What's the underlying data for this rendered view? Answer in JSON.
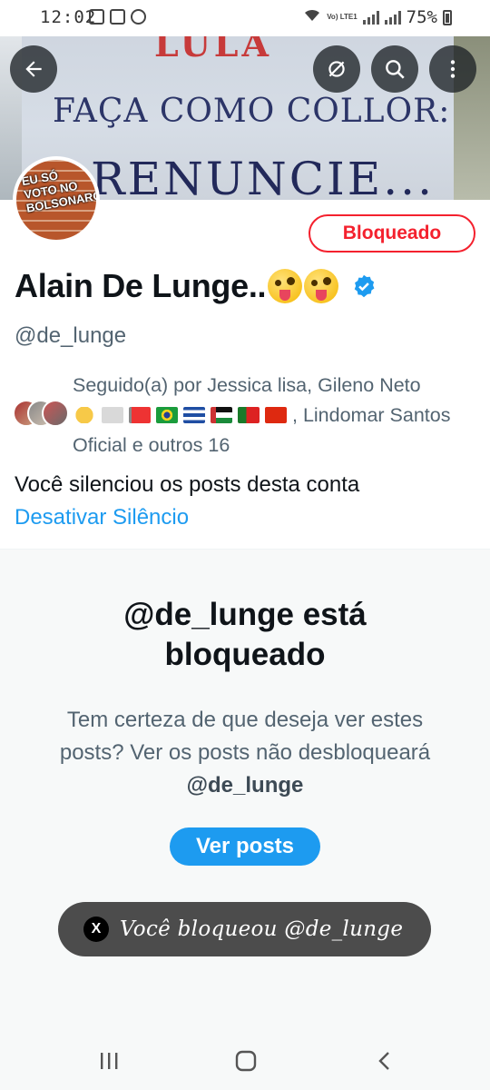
{
  "status_bar": {
    "time": "12:02",
    "battery": "75%",
    "network_label": "Vo) LTE1"
  },
  "header": {
    "back_icon": "arrow-left-icon",
    "actions": [
      {
        "name": "notifications-off-icon"
      },
      {
        "name": "search-icon"
      },
      {
        "name": "more-vertical-icon"
      }
    ]
  },
  "banner": {
    "text_top": "LULA",
    "text_line1": "FAÇA COMO COLLOR:",
    "text_line2": "RENUNCIE..."
  },
  "profile": {
    "avatar_text": "EU SÓ VOTO NO BOLSONARO",
    "blocked_label": "Bloqueado",
    "display_name": "Alain De Lunge..",
    "verified": true,
    "handle": "@de_lunge",
    "followed_by_prefix": "Seguido(a) por Jessica lisa, Gileno Neto",
    "followed_by_suffix": ", Lindomar Santos Oficial e outros 16",
    "muted_notice": "Você silenciou os posts desta conta",
    "unmute_link": "Desativar Silêncio"
  },
  "blocked_panel": {
    "title": "@de_lunge está bloqueado",
    "description": "Tem certeza de que deseja ver estes posts? Ver os posts não desbloqueará",
    "description_handle": "@de_lunge",
    "button_label": "Ver posts"
  },
  "toast": {
    "icon": "x-logo-icon",
    "icon_glyph": "X",
    "text": "Você bloqueou @de_lunge"
  },
  "nav_bar": {
    "items": [
      "recent-apps-icon",
      "home-icon",
      "back-icon"
    ]
  },
  "colors": {
    "accent": "#1d9bf0",
    "blocked_red": "#f4212e",
    "secondary_text": "#536471"
  }
}
